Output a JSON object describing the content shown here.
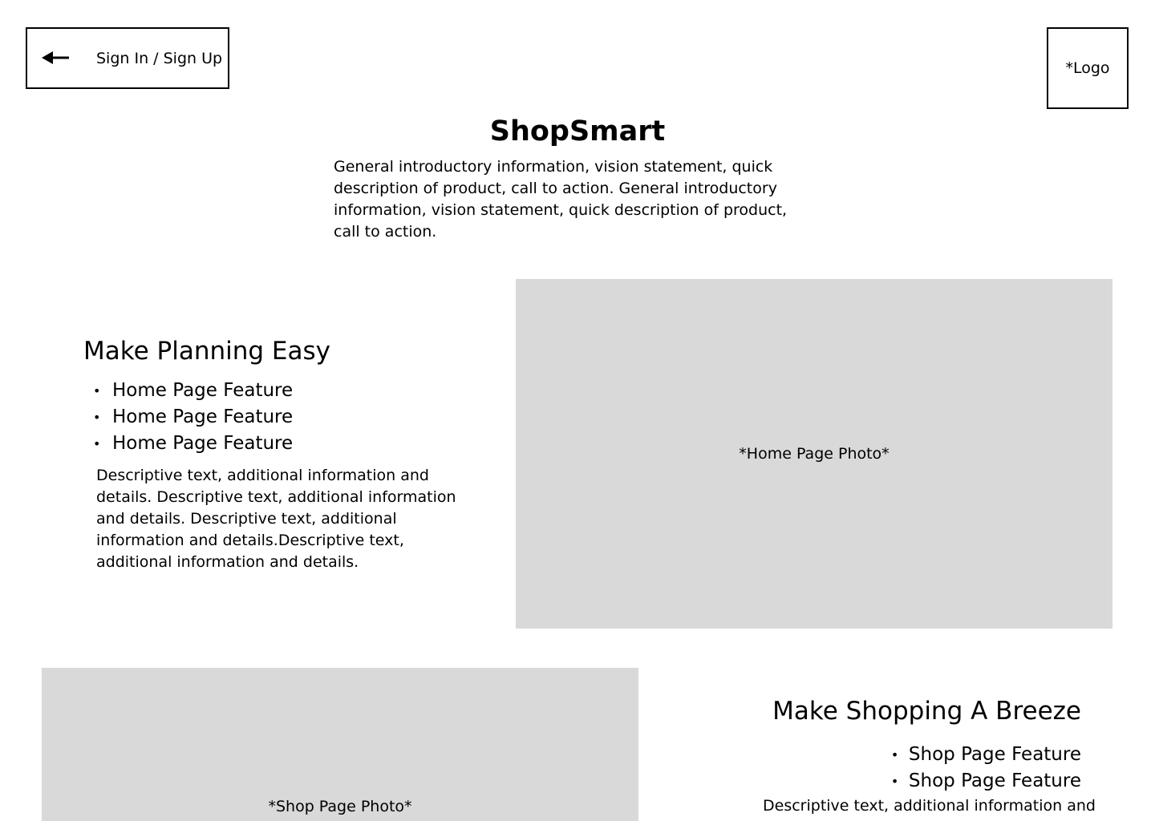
{
  "header": {
    "signin_label": "Sign In / Sign Up",
    "logo_label": "*Logo"
  },
  "hero": {
    "title": "ShopSmart",
    "intro": "General introductory information, vision statement, quick description of product, call to action. General introductory information, vision statement, quick description of product, call to action."
  },
  "planning": {
    "title": "Make Planning Easy",
    "features": [
      "Home Page Feature",
      "Home Page Feature",
      "Home Page Feature"
    ],
    "description": "Descriptive text, additional information and details. Descriptive text, additional information and details. Descriptive text, additional information and details.Descriptive text, additional information and details.",
    "photo_label": "*Home Page Photo*"
  },
  "shopping": {
    "title": "Make Shopping A Breeze",
    "features": [
      "Shop Page Feature",
      "Shop Page Feature"
    ],
    "description": "Descriptive text, additional information and",
    "photo_label": "*Shop Page Photo*"
  },
  "icons": {
    "back": "arrow-left-icon",
    "bullet": "•"
  }
}
